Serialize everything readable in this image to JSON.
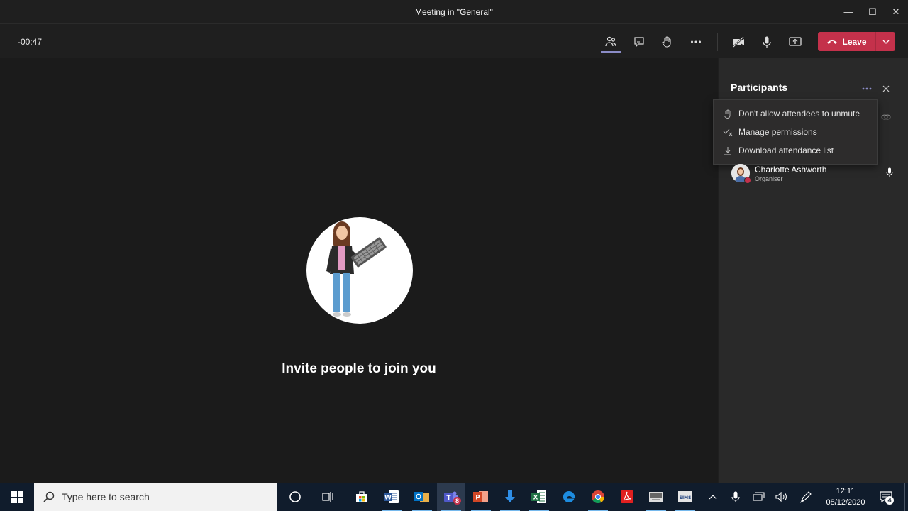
{
  "window": {
    "title": "Meeting in \"General\"",
    "minimize": "—",
    "maximize": "☐",
    "close": "✕"
  },
  "toolbar": {
    "timer": "-00:47",
    "leave_label": "Leave"
  },
  "stage": {
    "invite_text": "Invite people to join you"
  },
  "panel": {
    "title": "Participants",
    "menu": [
      {
        "label": "Don't allow attendees to unmute",
        "icon": "mute-hand-icon"
      },
      {
        "label": "Manage permissions",
        "icon": "permissions-icon"
      },
      {
        "label": "Download attendance list",
        "icon": "download-icon"
      }
    ],
    "participants": [
      {
        "name": "Charlotte Ashworth",
        "role": "Organiser"
      }
    ]
  },
  "taskbar": {
    "search_placeholder": "Type here to search",
    "teams_badge": "8",
    "time": "12:11",
    "date": "08/12/2020",
    "notifications_badge": "4",
    "apps": [
      "cortana",
      "task-view",
      "store",
      "word",
      "outlook",
      "teams",
      "powerpoint",
      "download",
      "excel",
      "edge",
      "chrome",
      "acrobat",
      "media",
      "sims"
    ]
  },
  "colors": {
    "leave": "#c4314b",
    "accent": "#8b8cc7",
    "taskbar": "#101c2c"
  }
}
